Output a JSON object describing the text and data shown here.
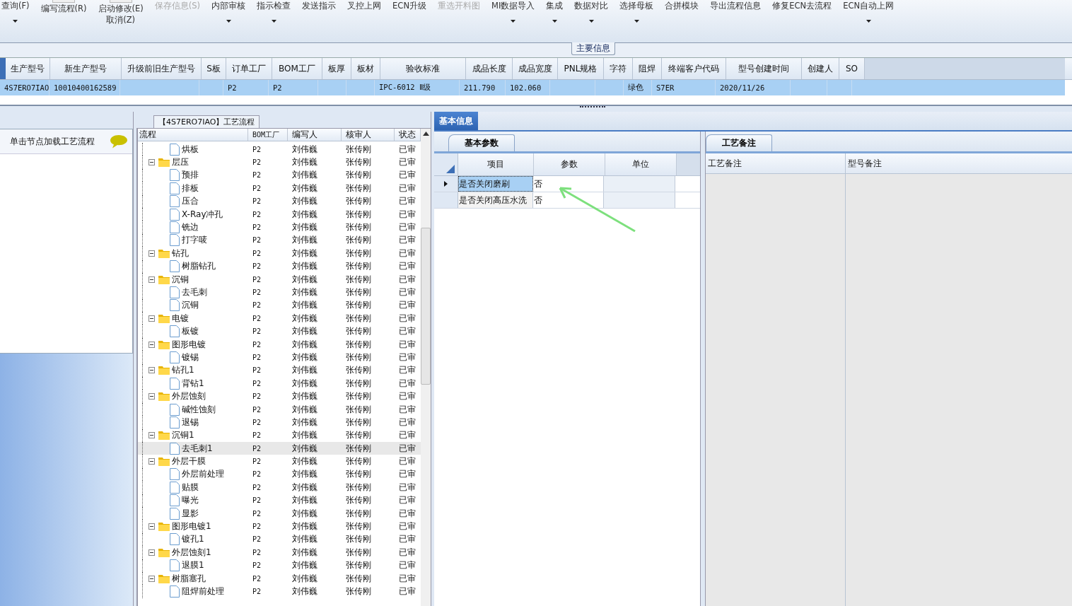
{
  "toolbar": [
    {
      "label": "查询(F)",
      "kind": "small",
      "disabled": false,
      "dropdown": true
    },
    {
      "label": "编写流程(R)",
      "kind": "large",
      "disabled": false,
      "dropdown": false
    },
    {
      "label": "启动修改(E)",
      "second": "取消(Z)",
      "kind": "large",
      "disabled": false,
      "dropdown": false
    },
    {
      "label": "保存信息(S)",
      "kind": "small",
      "disabled": true,
      "dropdown": false
    },
    {
      "label": "内部审核",
      "kind": "small",
      "disabled": false,
      "dropdown": true
    },
    {
      "label": "指示检查",
      "kind": "small",
      "disabled": false,
      "dropdown": true
    },
    {
      "label": "发送指示",
      "kind": "small",
      "disabled": false,
      "dropdown": false
    },
    {
      "label": "叉控上网",
      "kind": "small",
      "disabled": false,
      "dropdown": false
    },
    {
      "label": "ECN升级",
      "kind": "small",
      "disabled": false,
      "dropdown": false
    },
    {
      "label": "重选开料图",
      "kind": "small",
      "disabled": true,
      "dropdown": false
    },
    {
      "label": "MI数据导入",
      "kind": "small",
      "disabled": false,
      "dropdown": true
    },
    {
      "label": "集成",
      "kind": "small",
      "disabled": false,
      "dropdown": true
    },
    {
      "label": "数据对比",
      "kind": "small",
      "disabled": false,
      "dropdown": true
    },
    {
      "label": "选择母板",
      "kind": "small",
      "disabled": false,
      "dropdown": true
    },
    {
      "label": "合拼模块",
      "kind": "small",
      "disabled": false,
      "dropdown": false
    },
    {
      "label": "导出流程信息",
      "kind": "small",
      "disabled": false,
      "dropdown": false
    },
    {
      "label": "修复ECN去流程",
      "kind": "small",
      "disabled": false,
      "dropdown": false
    },
    {
      "label": "ECN自动上网",
      "kind": "small",
      "disabled": false,
      "dropdown": true
    }
  ],
  "main_group": {
    "title": "主要信息"
  },
  "main_table": {
    "columns": [
      "生产型号",
      "新生产型号",
      "升级前旧生产型号",
      "S板",
      "订单工厂",
      "BOM工厂",
      "板厚",
      "板材",
      "验收标准",
      "成品长度",
      "成品宽度",
      "PNL规格",
      "字符",
      "阻焊",
      "终端客户代码",
      "型号创建时间",
      "创建人",
      "SO"
    ],
    "rows": [
      {
        "selected": true,
        "cells": [
          "4S7ERO7IAO",
          "10010400162589",
          "",
          "",
          "P2",
          "P2",
          "",
          "",
          "IPC-6012 Ⅱ级",
          "211.790",
          "102.060",
          "",
          "",
          "绿色",
          "S7ER",
          "2020/11/26",
          "",
          ""
        ]
      }
    ]
  },
  "left_panel": {
    "hint": "单击节点加载工艺流程"
  },
  "flow_panel": {
    "title": "【4S7ERO7IAO】工艺流程",
    "columns": [
      "流程",
      "BOM工厂",
      "编写人",
      "核审人",
      "状态"
    ],
    "tree": [
      {
        "name": "烘板",
        "kind": "file",
        "selected": false,
        "bom": "P2",
        "writer": "刘伟巍",
        "reviewer": "张传刚",
        "status": "已审"
      },
      {
        "name": "层压",
        "kind": "folder",
        "selected": false,
        "bom": "P2",
        "writer": "刘伟巍",
        "reviewer": "张传刚",
        "status": "已审",
        "children": [
          {
            "name": "预排",
            "kind": "file",
            "selected": false,
            "bom": "P2",
            "writer": "刘伟巍",
            "reviewer": "张传刚",
            "status": "已审"
          },
          {
            "name": "排板",
            "kind": "file",
            "selected": false,
            "bom": "P2",
            "writer": "刘伟巍",
            "reviewer": "张传刚",
            "status": "已审"
          },
          {
            "name": "压合",
            "kind": "file",
            "selected": false,
            "bom": "P2",
            "writer": "刘伟巍",
            "reviewer": "张传刚",
            "status": "已审"
          },
          {
            "name": "X-Ray冲孔",
            "kind": "file",
            "selected": false,
            "bom": "P2",
            "writer": "刘伟巍",
            "reviewer": "张传刚",
            "status": "已审"
          },
          {
            "name": "铣边",
            "kind": "file",
            "selected": false,
            "bom": "P2",
            "writer": "刘伟巍",
            "reviewer": "张传刚",
            "status": "已审"
          },
          {
            "name": "打字唛",
            "kind": "file",
            "selected": false,
            "bom": "P2",
            "writer": "刘伟巍",
            "reviewer": "张传刚",
            "status": "已审"
          }
        ]
      },
      {
        "name": "钻孔",
        "kind": "folder",
        "selected": false,
        "bom": "P2",
        "writer": "刘伟巍",
        "reviewer": "张传刚",
        "status": "已审",
        "children": [
          {
            "name": "树脂钻孔",
            "kind": "file",
            "selected": false,
            "bom": "P2",
            "writer": "刘伟巍",
            "reviewer": "张传刚",
            "status": "已审"
          }
        ]
      },
      {
        "name": "沉铜",
        "kind": "folder",
        "selected": false,
        "bom": "P2",
        "writer": "刘伟巍",
        "reviewer": "张传刚",
        "status": "已审",
        "children": [
          {
            "name": "去毛刺",
            "kind": "file",
            "selected": false,
            "bom": "P2",
            "writer": "刘伟巍",
            "reviewer": "张传刚",
            "status": "已审"
          },
          {
            "name": "沉铜",
            "kind": "file",
            "selected": false,
            "bom": "P2",
            "writer": "刘伟巍",
            "reviewer": "张传刚",
            "status": "已审"
          }
        ]
      },
      {
        "name": "电镀",
        "kind": "folder",
        "selected": false,
        "bom": "P2",
        "writer": "刘伟巍",
        "reviewer": "张传刚",
        "status": "已审",
        "children": [
          {
            "name": "板镀",
            "kind": "file",
            "selected": false,
            "bom": "P2",
            "writer": "刘伟巍",
            "reviewer": "张传刚",
            "status": "已审"
          }
        ]
      },
      {
        "name": "图形电镀",
        "kind": "folder",
        "selected": false,
        "bom": "P2",
        "writer": "刘伟巍",
        "reviewer": "张传刚",
        "status": "已审",
        "children": [
          {
            "name": "镀锡",
            "kind": "file",
            "selected": false,
            "bom": "P2",
            "writer": "刘伟巍",
            "reviewer": "张传刚",
            "status": "已审"
          }
        ]
      },
      {
        "name": "钻孔1",
        "kind": "folder",
        "selected": false,
        "bom": "P2",
        "writer": "刘伟巍",
        "reviewer": "张传刚",
        "status": "已审",
        "children": [
          {
            "name": "背钻1",
            "kind": "file",
            "selected": false,
            "bom": "P2",
            "writer": "刘伟巍",
            "reviewer": "张传刚",
            "status": "已审"
          }
        ]
      },
      {
        "name": "外层蚀刻",
        "kind": "folder",
        "selected": false,
        "bom": "P2",
        "writer": "刘伟巍",
        "reviewer": "张传刚",
        "status": "已审",
        "children": [
          {
            "name": "碱性蚀刻",
            "kind": "file",
            "selected": false,
            "bom": "P2",
            "writer": "刘伟巍",
            "reviewer": "张传刚",
            "status": "已审"
          },
          {
            "name": "退锡",
            "kind": "file",
            "selected": false,
            "bom": "P2",
            "writer": "刘伟巍",
            "reviewer": "张传刚",
            "status": "已审"
          }
        ]
      },
      {
        "name": "沉铜1",
        "kind": "folder",
        "selected": false,
        "bom": "P2",
        "writer": "刘伟巍",
        "reviewer": "张传刚",
        "status": "已审",
        "children": [
          {
            "name": "去毛刺1",
            "kind": "file",
            "selected": true,
            "bom": "P2",
            "writer": "刘伟巍",
            "reviewer": "张传刚",
            "status": "已审"
          }
        ]
      },
      {
        "name": "外层干膜",
        "kind": "folder",
        "selected": false,
        "bom": "P2",
        "writer": "刘伟巍",
        "reviewer": "张传刚",
        "status": "已审",
        "children": [
          {
            "name": "外层前处理",
            "kind": "file",
            "selected": false,
            "bom": "P2",
            "writer": "刘伟巍",
            "reviewer": "张传刚",
            "status": "已审"
          },
          {
            "name": "贴膜",
            "kind": "file",
            "selected": false,
            "bom": "P2",
            "writer": "刘伟巍",
            "reviewer": "张传刚",
            "status": "已审"
          },
          {
            "name": "曝光",
            "kind": "file",
            "selected": false,
            "bom": "P2",
            "writer": "刘伟巍",
            "reviewer": "张传刚",
            "status": "已审"
          },
          {
            "name": "显影",
            "kind": "file",
            "selected": false,
            "bom": "P2",
            "writer": "刘伟巍",
            "reviewer": "张传刚",
            "status": "已审"
          }
        ]
      },
      {
        "name": "图形电镀1",
        "kind": "folder",
        "selected": false,
        "bom": "P2",
        "writer": "刘伟巍",
        "reviewer": "张传刚",
        "status": "已审",
        "children": [
          {
            "name": "镀孔1",
            "kind": "file",
            "selected": false,
            "bom": "P2",
            "writer": "刘伟巍",
            "reviewer": "张传刚",
            "status": "已审"
          }
        ]
      },
      {
        "name": "外层蚀刻1",
        "kind": "folder",
        "selected": false,
        "bom": "P2",
        "writer": "刘伟巍",
        "reviewer": "张传刚",
        "status": "已审",
        "children": [
          {
            "name": "退膜1",
            "kind": "file",
            "selected": false,
            "bom": "P2",
            "writer": "刘伟巍",
            "reviewer": "张传刚",
            "status": "已审"
          }
        ]
      },
      {
        "name": "树脂塞孔",
        "kind": "folder",
        "selected": false,
        "bom": "P2",
        "writer": "刘伟巍",
        "reviewer": "张传刚",
        "status": "已审",
        "children": [
          {
            "name": "阻焊前处理",
            "kind": "file",
            "selected": false,
            "bom": "P2",
            "writer": "刘伟巍",
            "reviewer": "张传刚",
            "status": "已审"
          }
        ]
      }
    ]
  },
  "right_tabs": [
    {
      "label": "基本信息",
      "selected": true
    }
  ],
  "params_panel": {
    "tab": "基本参数",
    "columns": [
      "项目",
      "参数",
      "单位"
    ],
    "rows": [
      {
        "item": "是否关闭磨刷",
        "value": "否",
        "selected": true
      },
      {
        "item": "是否关闭高压水洗",
        "value": "否",
        "selected": false
      }
    ]
  },
  "notes_panel": {
    "tab": "工艺备注",
    "columns": [
      "工艺备注",
      "型号备注"
    ]
  }
}
